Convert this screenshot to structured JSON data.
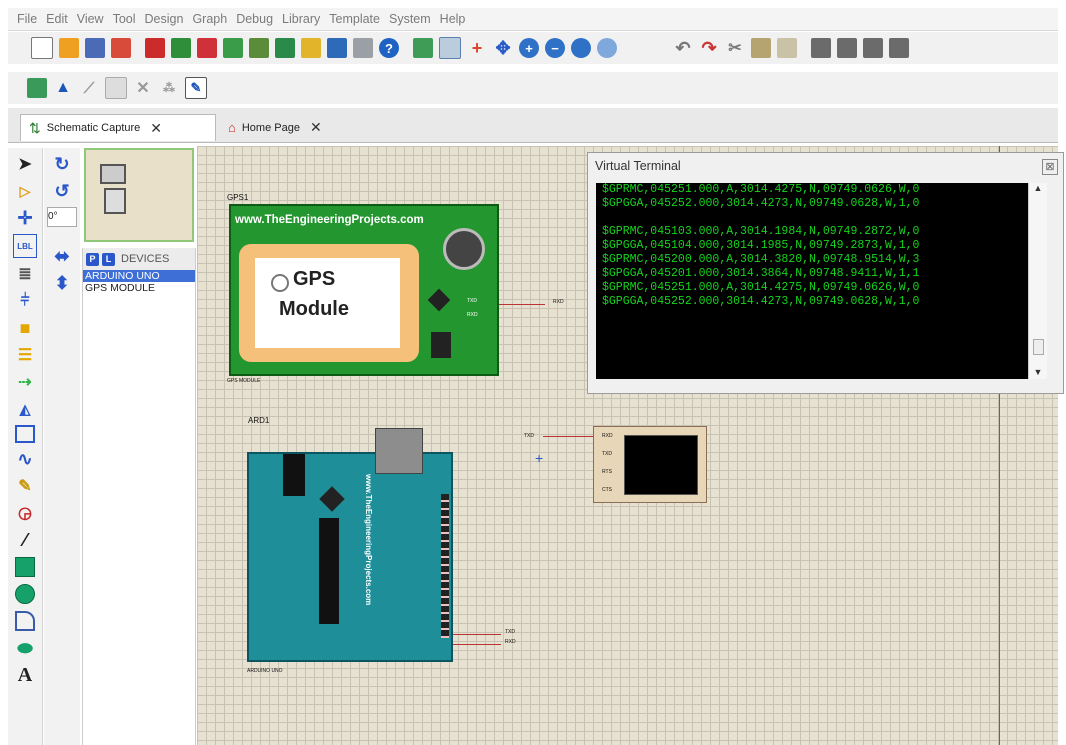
{
  "menu": [
    "File",
    "Edit",
    "View",
    "Tool",
    "Design",
    "Graph",
    "Debug",
    "Library",
    "Template",
    "System",
    "Help"
  ],
  "tabs": [
    {
      "label": "Schematic Capture",
      "close": "✕"
    },
    {
      "label": "Home Page",
      "close": "✕"
    }
  ],
  "overview": {
    "rotation_value": "0°"
  },
  "device_panel": {
    "p_button": "P",
    "l_button": "L",
    "title": "DEVICES",
    "items": [
      {
        "label": "ARDUINO UNO",
        "selected": true
      },
      {
        "label": "GPS MODULE",
        "selected": false
      }
    ]
  },
  "schematic": {
    "gps": {
      "ref": "GPS1",
      "website": "www.TheEngineeringProjects.com",
      "label_line1": "GPS",
      "label_line2": "Module",
      "footer": "GPS MODULE",
      "pins": [
        "TXD",
        "RXD"
      ],
      "net_label": "RXD"
    },
    "arduino": {
      "ref": "ARD1",
      "footer": "ARDUINO UNO",
      "website": "www.TheEngineeringProjects.com",
      "net_labels": [
        "TXD",
        "RXD"
      ]
    },
    "terminal_component": {
      "net_label": "TXD",
      "pins": [
        "RXD",
        "TXD",
        "RTS",
        "CTS"
      ]
    }
  },
  "virtual_terminal": {
    "title": "Virtual Terminal",
    "close": "⊠",
    "lines": [
      "$GPRMC,045251.000,A,3014.4275,N,09749.0626,W,0",
      "$GPGGA,045252.000,3014.4273,N,09749.0628,W,1,0",
      "",
      "$GPRMC,045103.000,A,3014.1984,N,09749.2872,W,0",
      "$GPGGA,045104.000,3014.1985,N,09749.2873,W,1,0",
      "$GPRMC,045200.000,A,3014.3820,N,09748.9514,W,3",
      "$GPGGA,045201.000,3014.3864,N,09748.9411,W,1,1",
      "$GPRMC,045251.000,A,3014.4275,N,09749.0626,W,0",
      "$GPGGA,045252.000,3014.4273,N,09749.0628,W,1,0"
    ]
  },
  "colors": {
    "gps_board": "#23962f",
    "arduino_board": "#1e8f98",
    "terminal_text": "#16d41e",
    "selection": "#3d6fd6"
  }
}
